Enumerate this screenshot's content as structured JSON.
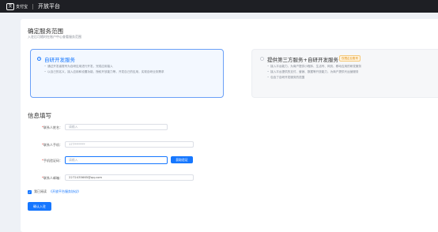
{
  "topbar": {
    "logo_mark": "支",
    "logo_text": "支付宝",
    "title": "开放平台"
  },
  "scope": {
    "title": "确定服务范围",
    "subtitle": "入驻后可随时在账户中心查看服务范围",
    "option1": {
      "title": "自研开发服务",
      "lines": [
        "通过开发者账号为自研应用进行开发，完成应用接入",
        "以自己的名义，接入应用和设置功能、授权开放能力等，开发自己的应用，实现自研业务需求"
      ],
      "selected": true
    },
    "option2": {
      "title": "提供第三方服务+自研开发服务",
      "badge": "仅限企业账号",
      "lines": [
        "接入平台能力，为商户提供小程序、生活号、网页、移动应用的研发服务",
        "接入平台提供的支付、营销、数据等开放能力，为商户提供代运营服务",
        "包含了自研开发服务的范围"
      ],
      "selected": false
    }
  },
  "form": {
    "title": "信息填写",
    "name_label": "联系人姓名：",
    "name_placeholder": "请输入",
    "phone_label": "联系人手机：",
    "phone_value": "177*******",
    "code_label": "手机验证码：",
    "code_placeholder": "请输入",
    "code_button": "获取验证",
    "email_label": "联系人邮箱：",
    "email_value": "2272435665@qq.com"
  },
  "agreement": {
    "prefix": "我已阅读",
    "link": "《开放平台服务协议》"
  },
  "confirm_button": "确认入驻",
  "colors": {
    "accent": "#1677ff",
    "topbar": "#1e1f24"
  }
}
